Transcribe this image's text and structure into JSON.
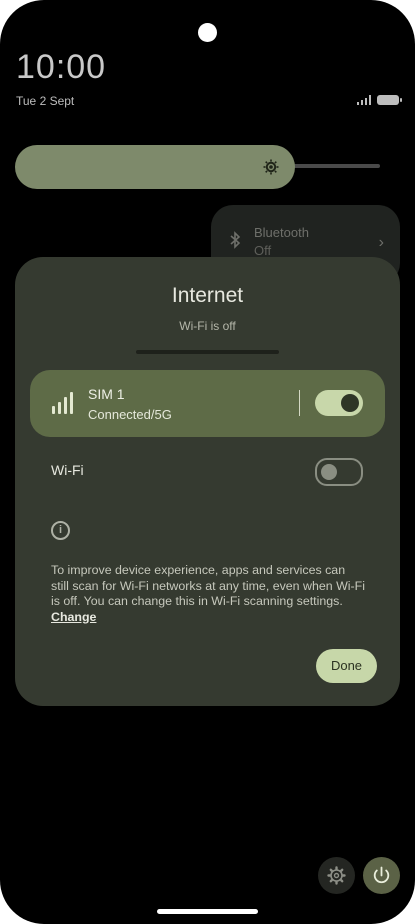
{
  "status_bar": {
    "time": "10:00",
    "date": "Tue 2 Sept"
  },
  "quick_settings": {
    "bluetooth": {
      "title": "Bluetooth",
      "state": "Off"
    }
  },
  "dialog": {
    "title": "Internet",
    "subtitle": "Wi-Fi is off",
    "sim": {
      "name": "SIM 1",
      "status": "Connected/5G",
      "enabled": true
    },
    "wifi": {
      "label": "Wi-Fi",
      "enabled": false
    },
    "info_text": "To improve device experience, apps and services can still scan for Wi-Fi networks at any time, even when Wi-Fi is off. You can change this in Wi-Fi scanning settings.",
    "change_link": "Change",
    "done_label": "Done"
  },
  "colors": {
    "dialog_bg": "#353a30",
    "sim_row_bg": "#5e6b47",
    "accent": "#c7d7a9",
    "brightness_fill": "#7e8a6b"
  },
  "icons": {
    "brightness": "brightness-sun-icon",
    "bluetooth": "bluetooth-icon",
    "signal": "signal-strength-icon",
    "info": "info-icon",
    "settings": "gear-icon",
    "power": "power-icon"
  }
}
